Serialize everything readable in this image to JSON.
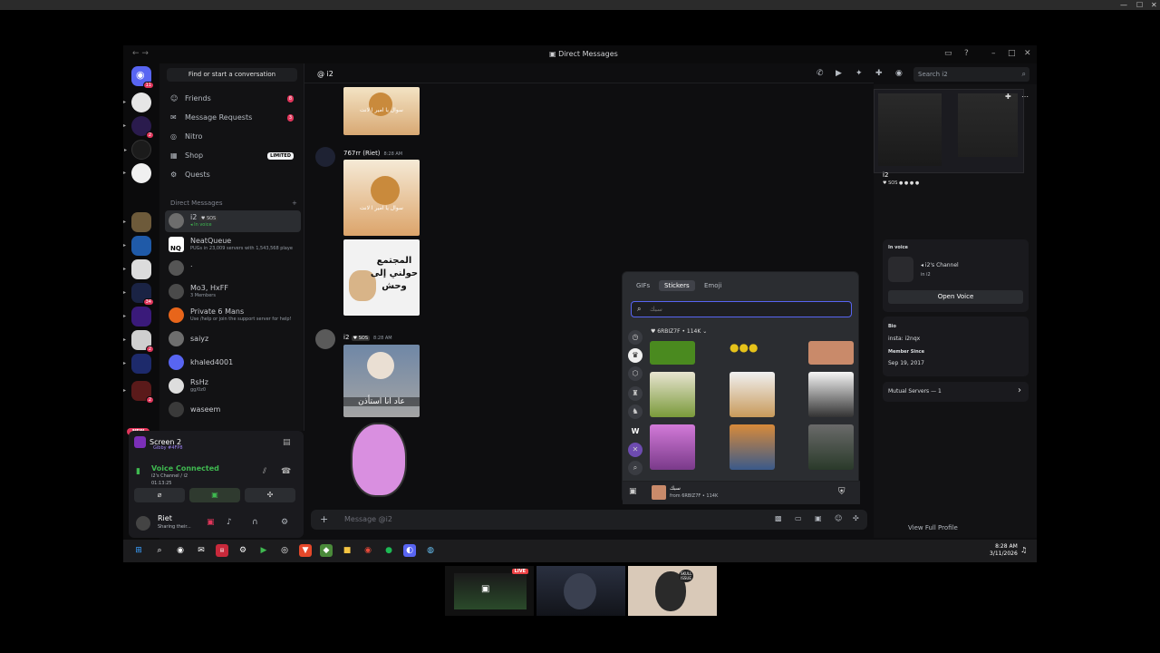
{
  "window": {
    "title": "Direct Messages"
  },
  "servers": {
    "badges": [
      "11",
      "2",
      "34",
      "2",
      "2"
    ],
    "new_pill": "NEW"
  },
  "sidebar": {
    "find_button": "Find or start a conversation",
    "nav": [
      {
        "label": "Friends",
        "badge": "8"
      },
      {
        "label": "Message Requests",
        "badge": "3"
      },
      {
        "label": "Nitro"
      },
      {
        "label": "Shop",
        "tag": "LIMITED"
      },
      {
        "label": "Quests"
      }
    ],
    "dm_header": "Direct Messages",
    "dms": [
      {
        "name": "i2",
        "tag": "SOS",
        "sub": "In voice"
      },
      {
        "name": "NeatQueue",
        "sub": "PUGs in 23,009 servers with 1,543,568 playe"
      },
      {
        "name": "."
      },
      {
        "name": "Mo3, HxFF",
        "sub": "3 Members"
      },
      {
        "name": "Private 6 Mans",
        "sub": "Use /help or join the support server for help!"
      },
      {
        "name": "saiyz"
      },
      {
        "name": "khaled4001"
      },
      {
        "name": "RsHz",
        "sub": "gg/0z0"
      },
      {
        "name": "waseem"
      }
    ]
  },
  "voice": {
    "screen_title": "Screen 2",
    "screen_sub": "Gibby #4FP8",
    "status": "Voice Connected",
    "channel": "i2's Channel / i2",
    "timer": "01:13:25"
  },
  "user": {
    "name": "Riet",
    "status": "Sharing their..."
  },
  "chat": {
    "recipient": "i2",
    "search_placeholder": "Search i2",
    "composer_placeholder": "Message @i2",
    "messages": [
      {
        "author": "767rr (Riet)",
        "time": "8:28 AM"
      },
      {
        "author": "i2",
        "tag": "SOS",
        "time": "8:28 AM"
      }
    ],
    "sticker_captions": {
      "dog": "سوال يا امير ا لانت",
      "cat_line1": "المجتمع",
      "cat_line2": "حولني إلى",
      "cat_line3": "وحش",
      "man": "عاد انا استأذن"
    }
  },
  "picker": {
    "tabs": [
      "GIFs",
      "Stickers",
      "Emoji"
    ],
    "active_tab": "Stickers",
    "search_placeholder": "سبك",
    "pack_name": "6RBIZ7F",
    "pack_count": "114K",
    "footer_name": "سبك",
    "footer_from": "from 6RBIZ7F • 114K"
  },
  "profile": {
    "username": "i2",
    "tag": "SOS",
    "in_voice_label": "In voice",
    "channel_name": "i2's Channel",
    "channel_sub": "in i2",
    "open_voice": "Open Voice",
    "bio_label": "Bio",
    "bio": "insta: i2nqx",
    "member_since_label": "Member Since",
    "member_since": "Sep 19, 2017",
    "mutual_servers": "Mutual Servers — 1",
    "view_full": "View Full Profile"
  },
  "taskbar": {
    "time": "8:28 AM",
    "date": "3/11/2026"
  },
  "thumbnails": {
    "live": "LIVE",
    "skull_badge": "SKULL ISSUE"
  },
  "colors": {
    "accent": "#5865f2",
    "danger": "#e1365b",
    "online": "#23a55a",
    "voice_green": "#3fb950"
  }
}
